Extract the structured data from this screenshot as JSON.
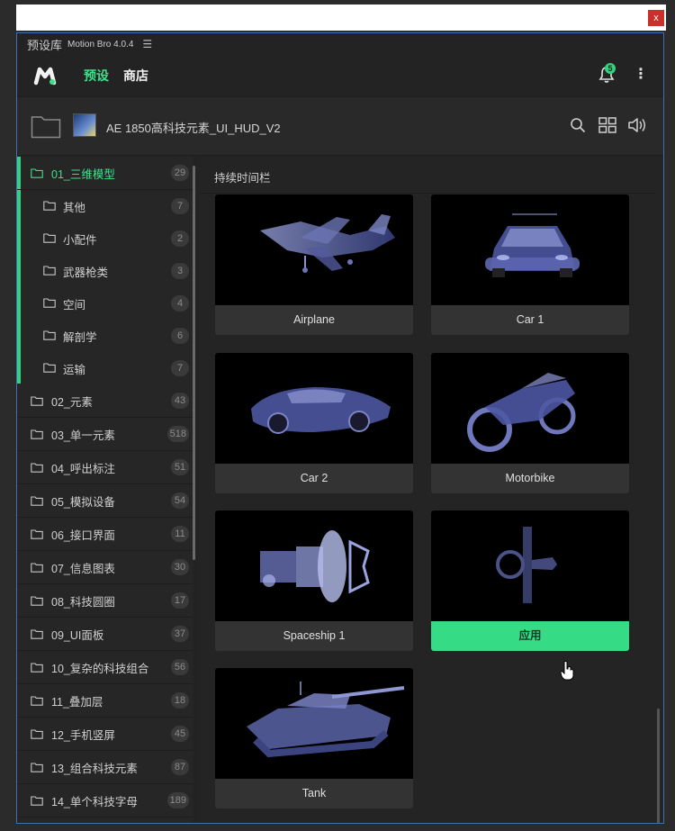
{
  "window": {
    "close_label": "x"
  },
  "panel": {
    "title": "预设库",
    "app_name": "Motion Bro 4.0.4",
    "menu_icon": "hamburger-icon"
  },
  "nav": {
    "tabs": [
      {
        "label": "预设",
        "active": true
      },
      {
        "label": "商店",
        "active": false
      }
    ],
    "notification_count": "5"
  },
  "project": {
    "name": "AE 1850高科技元素_UI_HUD_V2"
  },
  "sidebar": {
    "items": [
      {
        "label": "01_三维模型",
        "count": "29",
        "level": "top",
        "active": true
      },
      {
        "label": "其他",
        "count": "7",
        "level": "sub"
      },
      {
        "label": "小配件",
        "count": "2",
        "level": "sub"
      },
      {
        "label": "武器枪类",
        "count": "3",
        "level": "sub"
      },
      {
        "label": "空间",
        "count": "4",
        "level": "sub"
      },
      {
        "label": "解剖学",
        "count": "6",
        "level": "sub"
      },
      {
        "label": "运输",
        "count": "7",
        "level": "sub"
      },
      {
        "label": "02_元素",
        "count": "43",
        "level": "top"
      },
      {
        "label": "03_单一元素",
        "count": "518",
        "level": "top"
      },
      {
        "label": "04_呼出标注",
        "count": "51",
        "level": "top"
      },
      {
        "label": "05_模拟设备",
        "count": "54",
        "level": "top"
      },
      {
        "label": "06_接口界面",
        "count": "11",
        "level": "top"
      },
      {
        "label": "07_信息图表",
        "count": "30",
        "level": "top"
      },
      {
        "label": "08_科技圆圈",
        "count": "17",
        "level": "top"
      },
      {
        "label": "09_UI面板",
        "count": "37",
        "level": "top"
      },
      {
        "label": "10_复杂的科技组合",
        "count": "56",
        "level": "top"
      },
      {
        "label": "11_叠加层",
        "count": "18",
        "level": "top"
      },
      {
        "label": "12_手机竖屏",
        "count": "45",
        "level": "top"
      },
      {
        "label": "13_组合科技元素",
        "count": "87",
        "level": "top"
      },
      {
        "label": "14_单个科技字母",
        "count": "189",
        "level": "top"
      }
    ]
  },
  "main": {
    "section_title": "持续时间栏",
    "cards": [
      {
        "caption": "Airplane",
        "icon": "airplane-model"
      },
      {
        "caption": "Car 1",
        "icon": "car-model"
      },
      {
        "caption": "Car 2",
        "icon": "sports-car-model"
      },
      {
        "caption": "Motorbike",
        "icon": "motorbike-model"
      },
      {
        "caption": "Spaceship 1",
        "icon": "spaceship-model"
      },
      {
        "caption": "应用",
        "icon": "satellite-model",
        "hover": true
      },
      {
        "caption": "Tank",
        "icon": "tank-model"
      }
    ]
  },
  "colors": {
    "accent": "#3fe08a",
    "apply": "#35db85",
    "frame": "#3b6fb6"
  }
}
